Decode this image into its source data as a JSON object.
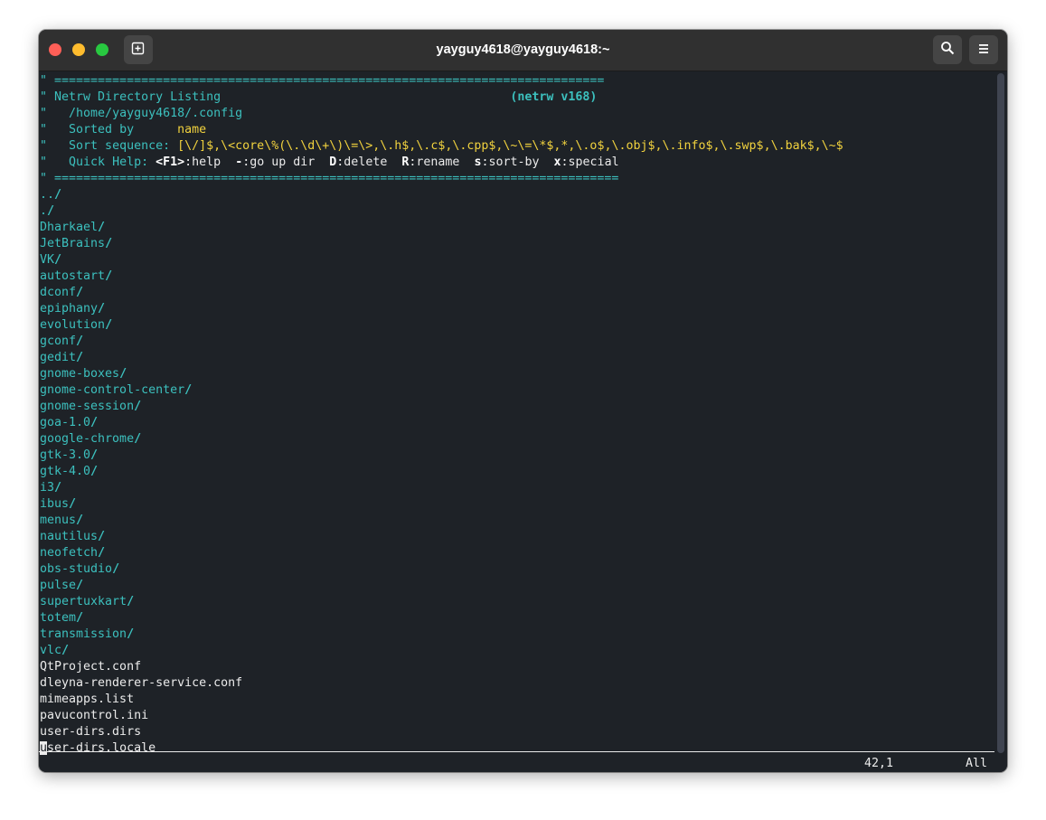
{
  "window": {
    "title": "yayguy4618@yayguy4618:~"
  },
  "icons": {
    "new_tab": "new-tab-icon",
    "search": "search-icon",
    "menu": "hamburger-menu-icon"
  },
  "header": {
    "separator_top": "\" ============================================================================",
    "title_prefix": "\" ",
    "title": "Netrw Directory Listing",
    "title_gap": "                                        ",
    "version": "(netrw v168)",
    "path_prefix": "\"   ",
    "path": "/home/yayguy4618/.config",
    "sorted_prefix": "\"   ",
    "sorted_label": "Sorted by      ",
    "sorted_value": "name",
    "sortseq_prefix": "\"   ",
    "sortseq_label": "Sort sequence: ",
    "sortseq_value": "[\\/]$,\\<core\\%(\\.\\d\\+\\)\\=\\>,\\.h$,\\.c$,\\.cpp$,\\~\\=\\*$,*,\\.o$,\\.obj$,\\.info$,\\.swp$,\\.bak$,\\~$",
    "help_prefix": "\"   ",
    "help_label": "Quick Help: ",
    "help_items": [
      {
        "key": "<F1>",
        "desc": ":help  "
      },
      {
        "key": "-",
        "desc": ":go up dir  "
      },
      {
        "key": "D",
        "desc": ":delete  "
      },
      {
        "key": "R",
        "desc": ":rename  "
      },
      {
        "key": "s",
        "desc": ":sort-by  "
      },
      {
        "key": "x",
        "desc": ":special"
      }
    ],
    "separator_bottom": "\" =============================================================================="
  },
  "directories": [
    "..",
    ".",
    "Dharkael",
    "JetBrains",
    "VK",
    "autostart",
    "dconf",
    "epiphany",
    "evolution",
    "gconf",
    "gedit",
    "gnome-boxes",
    "gnome-control-center",
    "gnome-session",
    "goa-1.0",
    "google-chrome",
    "gtk-3.0",
    "gtk-4.0",
    "i3",
    "ibus",
    "menus",
    "nautilus",
    "neofetch",
    "obs-studio",
    "pulse",
    "supertuxkart",
    "totem",
    "transmission",
    "vlc"
  ],
  "dir_suffix": "/",
  "files": [
    "QtProject.conf",
    "dleyna-renderer-service.conf",
    "mimeapps.list",
    "pavucontrol.ini",
    "user-dirs.dirs"
  ],
  "last_file": {
    "cursor_char": "u",
    "rest": "ser-dirs.locale"
  },
  "status": {
    "position": "42,1",
    "scroll": "All"
  },
  "colors": {
    "terminal_bg": "#1e2227",
    "titlebar_bg": "#303030",
    "cyan": "#3cc0be",
    "yellow": "#f1d23e",
    "foreground": "#ebebeb"
  }
}
